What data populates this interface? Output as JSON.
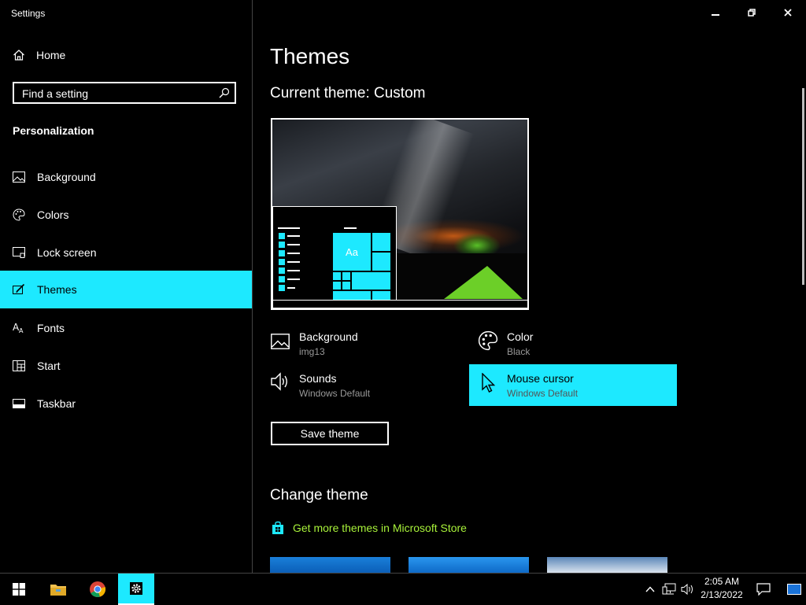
{
  "app": {
    "title": "Settings"
  },
  "sidebar": {
    "home": "Home",
    "search_placeholder": "Find a setting",
    "section": "Personalization",
    "items": [
      {
        "label": "Background",
        "icon": "picture-icon"
      },
      {
        "label": "Colors",
        "icon": "palette-icon"
      },
      {
        "label": "Lock screen",
        "icon": "lock-screen-icon"
      },
      {
        "label": "Themes",
        "icon": "brush-icon",
        "selected": true
      },
      {
        "label": "Fonts",
        "icon": "font-icon"
      },
      {
        "label": "Start",
        "icon": "start-icon"
      },
      {
        "label": "Taskbar",
        "icon": "taskbar-icon"
      }
    ]
  },
  "main": {
    "title": "Themes",
    "current_theme": "Current theme: Custom",
    "preview_tile_label": "Aa",
    "properties": [
      {
        "label": "Background",
        "value": "img13",
        "icon": "picture-icon"
      },
      {
        "label": "Color",
        "value": "Black",
        "icon": "palette-icon"
      },
      {
        "label": "Sounds",
        "value": "Windows Default",
        "icon": "speaker-icon"
      },
      {
        "label": "Mouse cursor",
        "value": "Windows Default",
        "icon": "cursor-icon",
        "selected": true
      }
    ],
    "save_button": "Save theme",
    "change_theme": "Change theme",
    "store_link": "Get more themes in Microsoft Store"
  },
  "taskbar": {
    "time": "2:05 AM",
    "date": "2/13/2022",
    "pinned": [
      "windows-start-icon",
      "file-explorer-icon",
      "chrome-icon",
      "settings-icon"
    ]
  },
  "colors": {
    "accent": "#1de9ff",
    "background": "#000000",
    "link": "#a8f23a"
  }
}
